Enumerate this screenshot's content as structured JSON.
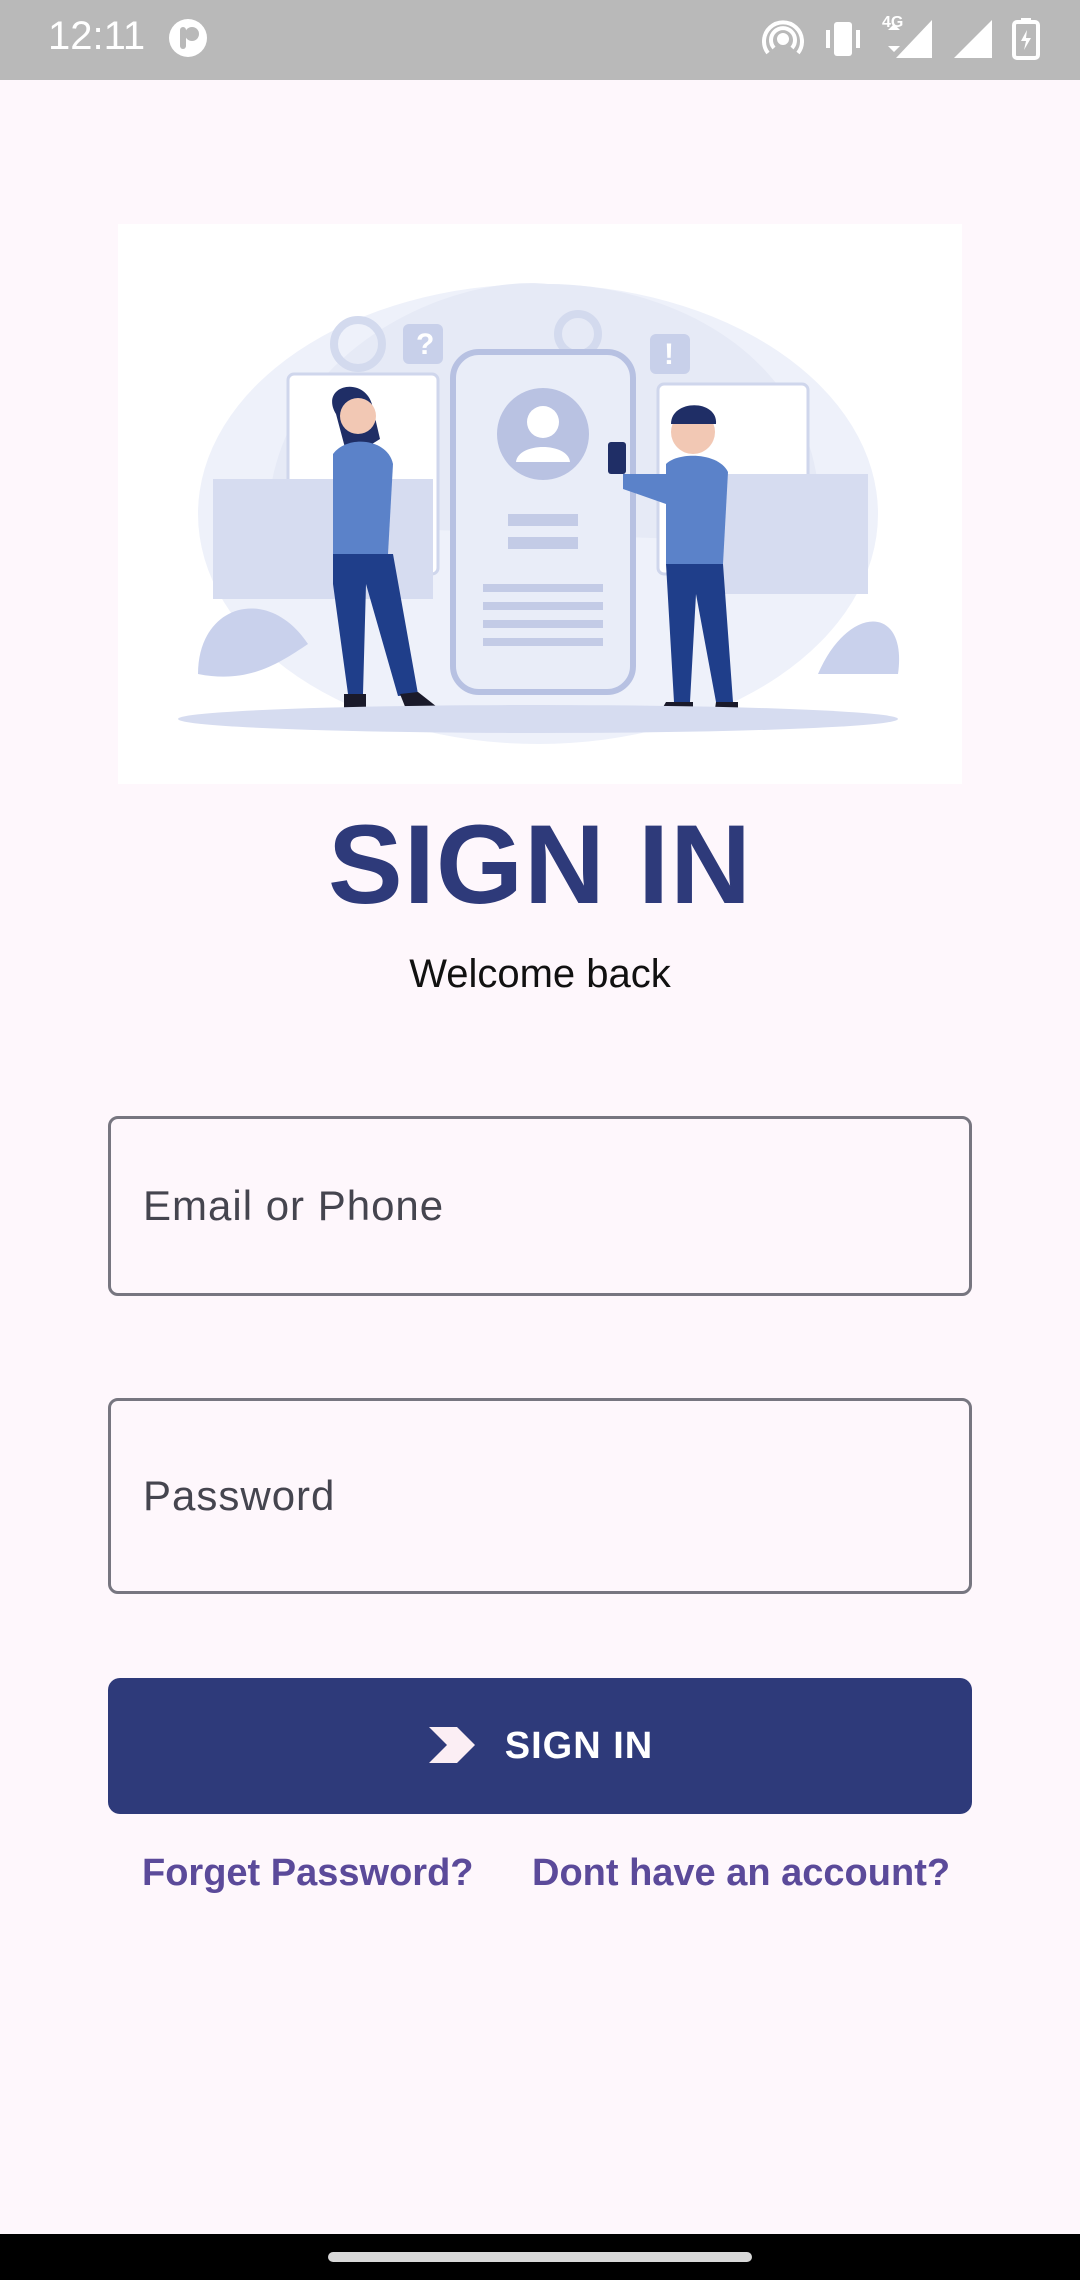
{
  "status_bar": {
    "time": "12:11",
    "network_label": "4G",
    "icons": [
      "app-notification-icon",
      "hotspot-icon",
      "vibrate-icon",
      "mobile-data-icon",
      "signal-icon",
      "battery-icon"
    ]
  },
  "hero": {
    "image": "two-people-profile-illustration"
  },
  "header": {
    "title": "SIGN IN",
    "subtitle": "Welcome back"
  },
  "form": {
    "email": {
      "placeholder": "Email or Phone",
      "value": ""
    },
    "password": {
      "placeholder": "Password",
      "value": ""
    },
    "submit": {
      "label": "SIGN IN",
      "icon": "chevron-arrow-icon"
    }
  },
  "links": {
    "forgot": "Forget Password?",
    "signup": "Dont have an account?"
  },
  "colors": {
    "primary": "#2e3a7a",
    "link": "#5b4a9a",
    "background": "#fef7fc",
    "status_bar": "#b9b9b9"
  }
}
